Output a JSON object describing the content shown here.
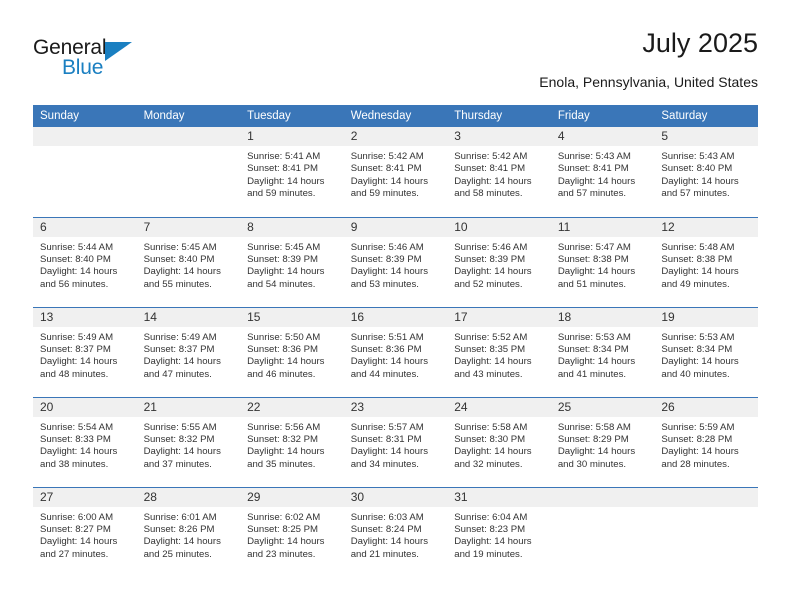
{
  "brand": {
    "name_top": "General",
    "name_bottom": "Blue",
    "triangle_color": "#1a7fc1"
  },
  "header": {
    "title": "July 2025",
    "location": "Enola, Pennsylvania, United States",
    "header_bg_color": "#3a76b8",
    "daynum_bg_color": "#f0f0f0"
  },
  "weekday_headers": [
    "Sunday",
    "Monday",
    "Tuesday",
    "Wednesday",
    "Thursday",
    "Friday",
    "Saturday"
  ],
  "weeks": [
    [
      {
        "day": "",
        "sunrise": "",
        "sunset": "",
        "daylight_1": "",
        "daylight_2": "",
        "empty": true
      },
      {
        "day": "",
        "sunrise": "",
        "sunset": "",
        "daylight_1": "",
        "daylight_2": "",
        "empty": true
      },
      {
        "day": "1",
        "sunrise": "Sunrise: 5:41 AM",
        "sunset": "Sunset: 8:41 PM",
        "daylight_1": "Daylight: 14 hours",
        "daylight_2": "and 59 minutes."
      },
      {
        "day": "2",
        "sunrise": "Sunrise: 5:42 AM",
        "sunset": "Sunset: 8:41 PM",
        "daylight_1": "Daylight: 14 hours",
        "daylight_2": "and 59 minutes."
      },
      {
        "day": "3",
        "sunrise": "Sunrise: 5:42 AM",
        "sunset": "Sunset: 8:41 PM",
        "daylight_1": "Daylight: 14 hours",
        "daylight_2": "and 58 minutes."
      },
      {
        "day": "4",
        "sunrise": "Sunrise: 5:43 AM",
        "sunset": "Sunset: 8:41 PM",
        "daylight_1": "Daylight: 14 hours",
        "daylight_2": "and 57 minutes."
      },
      {
        "day": "5",
        "sunrise": "Sunrise: 5:43 AM",
        "sunset": "Sunset: 8:40 PM",
        "daylight_1": "Daylight: 14 hours",
        "daylight_2": "and 57 minutes."
      }
    ],
    [
      {
        "day": "6",
        "sunrise": "Sunrise: 5:44 AM",
        "sunset": "Sunset: 8:40 PM",
        "daylight_1": "Daylight: 14 hours",
        "daylight_2": "and 56 minutes."
      },
      {
        "day": "7",
        "sunrise": "Sunrise: 5:45 AM",
        "sunset": "Sunset: 8:40 PM",
        "daylight_1": "Daylight: 14 hours",
        "daylight_2": "and 55 minutes."
      },
      {
        "day": "8",
        "sunrise": "Sunrise: 5:45 AM",
        "sunset": "Sunset: 8:39 PM",
        "daylight_1": "Daylight: 14 hours",
        "daylight_2": "and 54 minutes."
      },
      {
        "day": "9",
        "sunrise": "Sunrise: 5:46 AM",
        "sunset": "Sunset: 8:39 PM",
        "daylight_1": "Daylight: 14 hours",
        "daylight_2": "and 53 minutes."
      },
      {
        "day": "10",
        "sunrise": "Sunrise: 5:46 AM",
        "sunset": "Sunset: 8:39 PM",
        "daylight_1": "Daylight: 14 hours",
        "daylight_2": "and 52 minutes."
      },
      {
        "day": "11",
        "sunrise": "Sunrise: 5:47 AM",
        "sunset": "Sunset: 8:38 PM",
        "daylight_1": "Daylight: 14 hours",
        "daylight_2": "and 51 minutes."
      },
      {
        "day": "12",
        "sunrise": "Sunrise: 5:48 AM",
        "sunset": "Sunset: 8:38 PM",
        "daylight_1": "Daylight: 14 hours",
        "daylight_2": "and 49 minutes."
      }
    ],
    [
      {
        "day": "13",
        "sunrise": "Sunrise: 5:49 AM",
        "sunset": "Sunset: 8:37 PM",
        "daylight_1": "Daylight: 14 hours",
        "daylight_2": "and 48 minutes."
      },
      {
        "day": "14",
        "sunrise": "Sunrise: 5:49 AM",
        "sunset": "Sunset: 8:37 PM",
        "daylight_1": "Daylight: 14 hours",
        "daylight_2": "and 47 minutes."
      },
      {
        "day": "15",
        "sunrise": "Sunrise: 5:50 AM",
        "sunset": "Sunset: 8:36 PM",
        "daylight_1": "Daylight: 14 hours",
        "daylight_2": "and 46 minutes."
      },
      {
        "day": "16",
        "sunrise": "Sunrise: 5:51 AM",
        "sunset": "Sunset: 8:36 PM",
        "daylight_1": "Daylight: 14 hours",
        "daylight_2": "and 44 minutes."
      },
      {
        "day": "17",
        "sunrise": "Sunrise: 5:52 AM",
        "sunset": "Sunset: 8:35 PM",
        "daylight_1": "Daylight: 14 hours",
        "daylight_2": "and 43 minutes."
      },
      {
        "day": "18",
        "sunrise": "Sunrise: 5:53 AM",
        "sunset": "Sunset: 8:34 PM",
        "daylight_1": "Daylight: 14 hours",
        "daylight_2": "and 41 minutes."
      },
      {
        "day": "19",
        "sunrise": "Sunrise: 5:53 AM",
        "sunset": "Sunset: 8:34 PM",
        "daylight_1": "Daylight: 14 hours",
        "daylight_2": "and 40 minutes."
      }
    ],
    [
      {
        "day": "20",
        "sunrise": "Sunrise: 5:54 AM",
        "sunset": "Sunset: 8:33 PM",
        "daylight_1": "Daylight: 14 hours",
        "daylight_2": "and 38 minutes."
      },
      {
        "day": "21",
        "sunrise": "Sunrise: 5:55 AM",
        "sunset": "Sunset: 8:32 PM",
        "daylight_1": "Daylight: 14 hours",
        "daylight_2": "and 37 minutes."
      },
      {
        "day": "22",
        "sunrise": "Sunrise: 5:56 AM",
        "sunset": "Sunset: 8:32 PM",
        "daylight_1": "Daylight: 14 hours",
        "daylight_2": "and 35 minutes."
      },
      {
        "day": "23",
        "sunrise": "Sunrise: 5:57 AM",
        "sunset": "Sunset: 8:31 PM",
        "daylight_1": "Daylight: 14 hours",
        "daylight_2": "and 34 minutes."
      },
      {
        "day": "24",
        "sunrise": "Sunrise: 5:58 AM",
        "sunset": "Sunset: 8:30 PM",
        "daylight_1": "Daylight: 14 hours",
        "daylight_2": "and 32 minutes."
      },
      {
        "day": "25",
        "sunrise": "Sunrise: 5:58 AM",
        "sunset": "Sunset: 8:29 PM",
        "daylight_1": "Daylight: 14 hours",
        "daylight_2": "and 30 minutes."
      },
      {
        "day": "26",
        "sunrise": "Sunrise: 5:59 AM",
        "sunset": "Sunset: 8:28 PM",
        "daylight_1": "Daylight: 14 hours",
        "daylight_2": "and 28 minutes."
      }
    ],
    [
      {
        "day": "27",
        "sunrise": "Sunrise: 6:00 AM",
        "sunset": "Sunset: 8:27 PM",
        "daylight_1": "Daylight: 14 hours",
        "daylight_2": "and 27 minutes."
      },
      {
        "day": "28",
        "sunrise": "Sunrise: 6:01 AM",
        "sunset": "Sunset: 8:26 PM",
        "daylight_1": "Daylight: 14 hours",
        "daylight_2": "and 25 minutes."
      },
      {
        "day": "29",
        "sunrise": "Sunrise: 6:02 AM",
        "sunset": "Sunset: 8:25 PM",
        "daylight_1": "Daylight: 14 hours",
        "daylight_2": "and 23 minutes."
      },
      {
        "day": "30",
        "sunrise": "Sunrise: 6:03 AM",
        "sunset": "Sunset: 8:24 PM",
        "daylight_1": "Daylight: 14 hours",
        "daylight_2": "and 21 minutes."
      },
      {
        "day": "31",
        "sunrise": "Sunrise: 6:04 AM",
        "sunset": "Sunset: 8:23 PM",
        "daylight_1": "Daylight: 14 hours",
        "daylight_2": "and 19 minutes."
      },
      {
        "day": "",
        "sunrise": "",
        "sunset": "",
        "daylight_1": "",
        "daylight_2": "",
        "empty": true
      },
      {
        "day": "",
        "sunrise": "",
        "sunset": "",
        "daylight_1": "",
        "daylight_2": "",
        "empty": true
      }
    ]
  ]
}
